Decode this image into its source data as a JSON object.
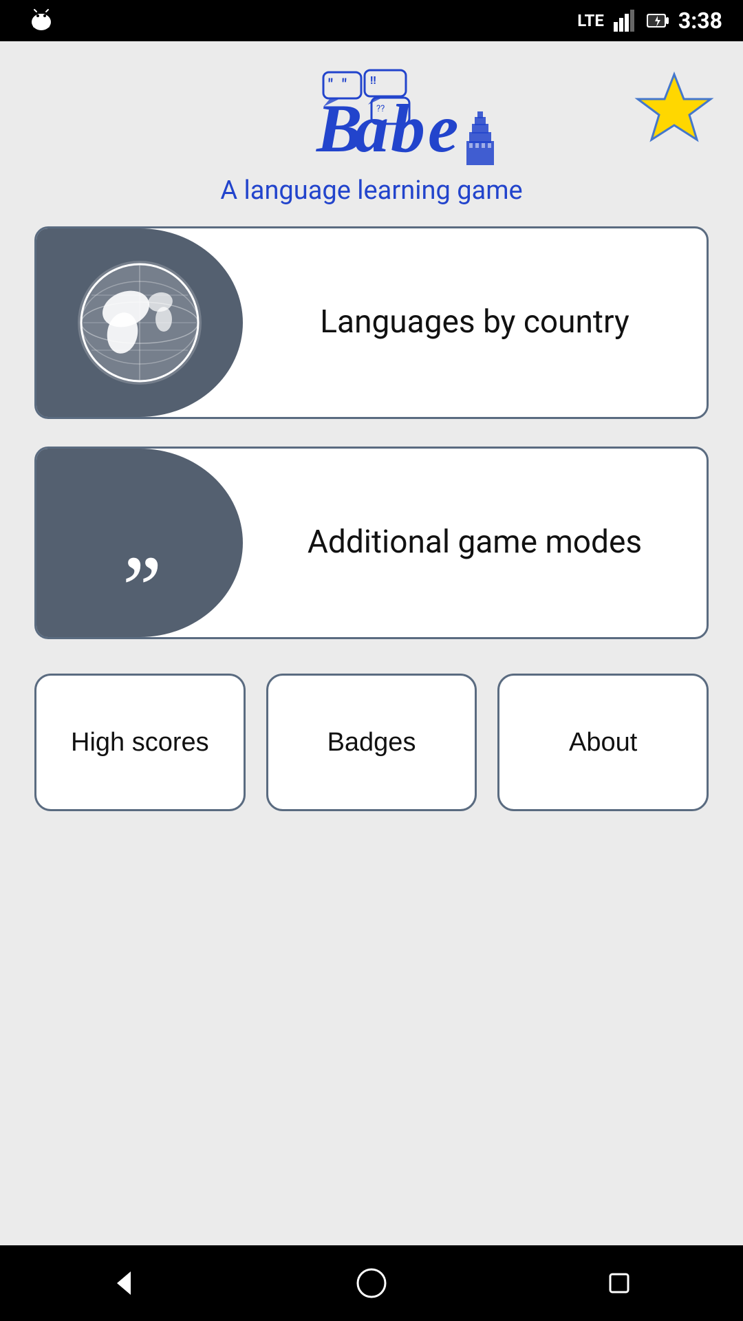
{
  "statusBar": {
    "time": "3:38",
    "network": "LTE",
    "battery": "charging"
  },
  "header": {
    "appName": "Babel",
    "subtitle": "A language learning game",
    "starButton": "star"
  },
  "cards": [
    {
      "id": "languages-by-country",
      "icon": "globe-icon",
      "label": "Languages by\ncountry"
    },
    {
      "id": "additional-game-modes",
      "icon": "quote-icon",
      "label": "Additional game modes"
    }
  ],
  "bottomButtons": [
    {
      "id": "high-scores",
      "label": "High scores"
    },
    {
      "id": "badges",
      "label": "Badges"
    },
    {
      "id": "about",
      "label": "About"
    }
  ],
  "navBar": {
    "back": "back",
    "home": "home",
    "recents": "recents"
  }
}
